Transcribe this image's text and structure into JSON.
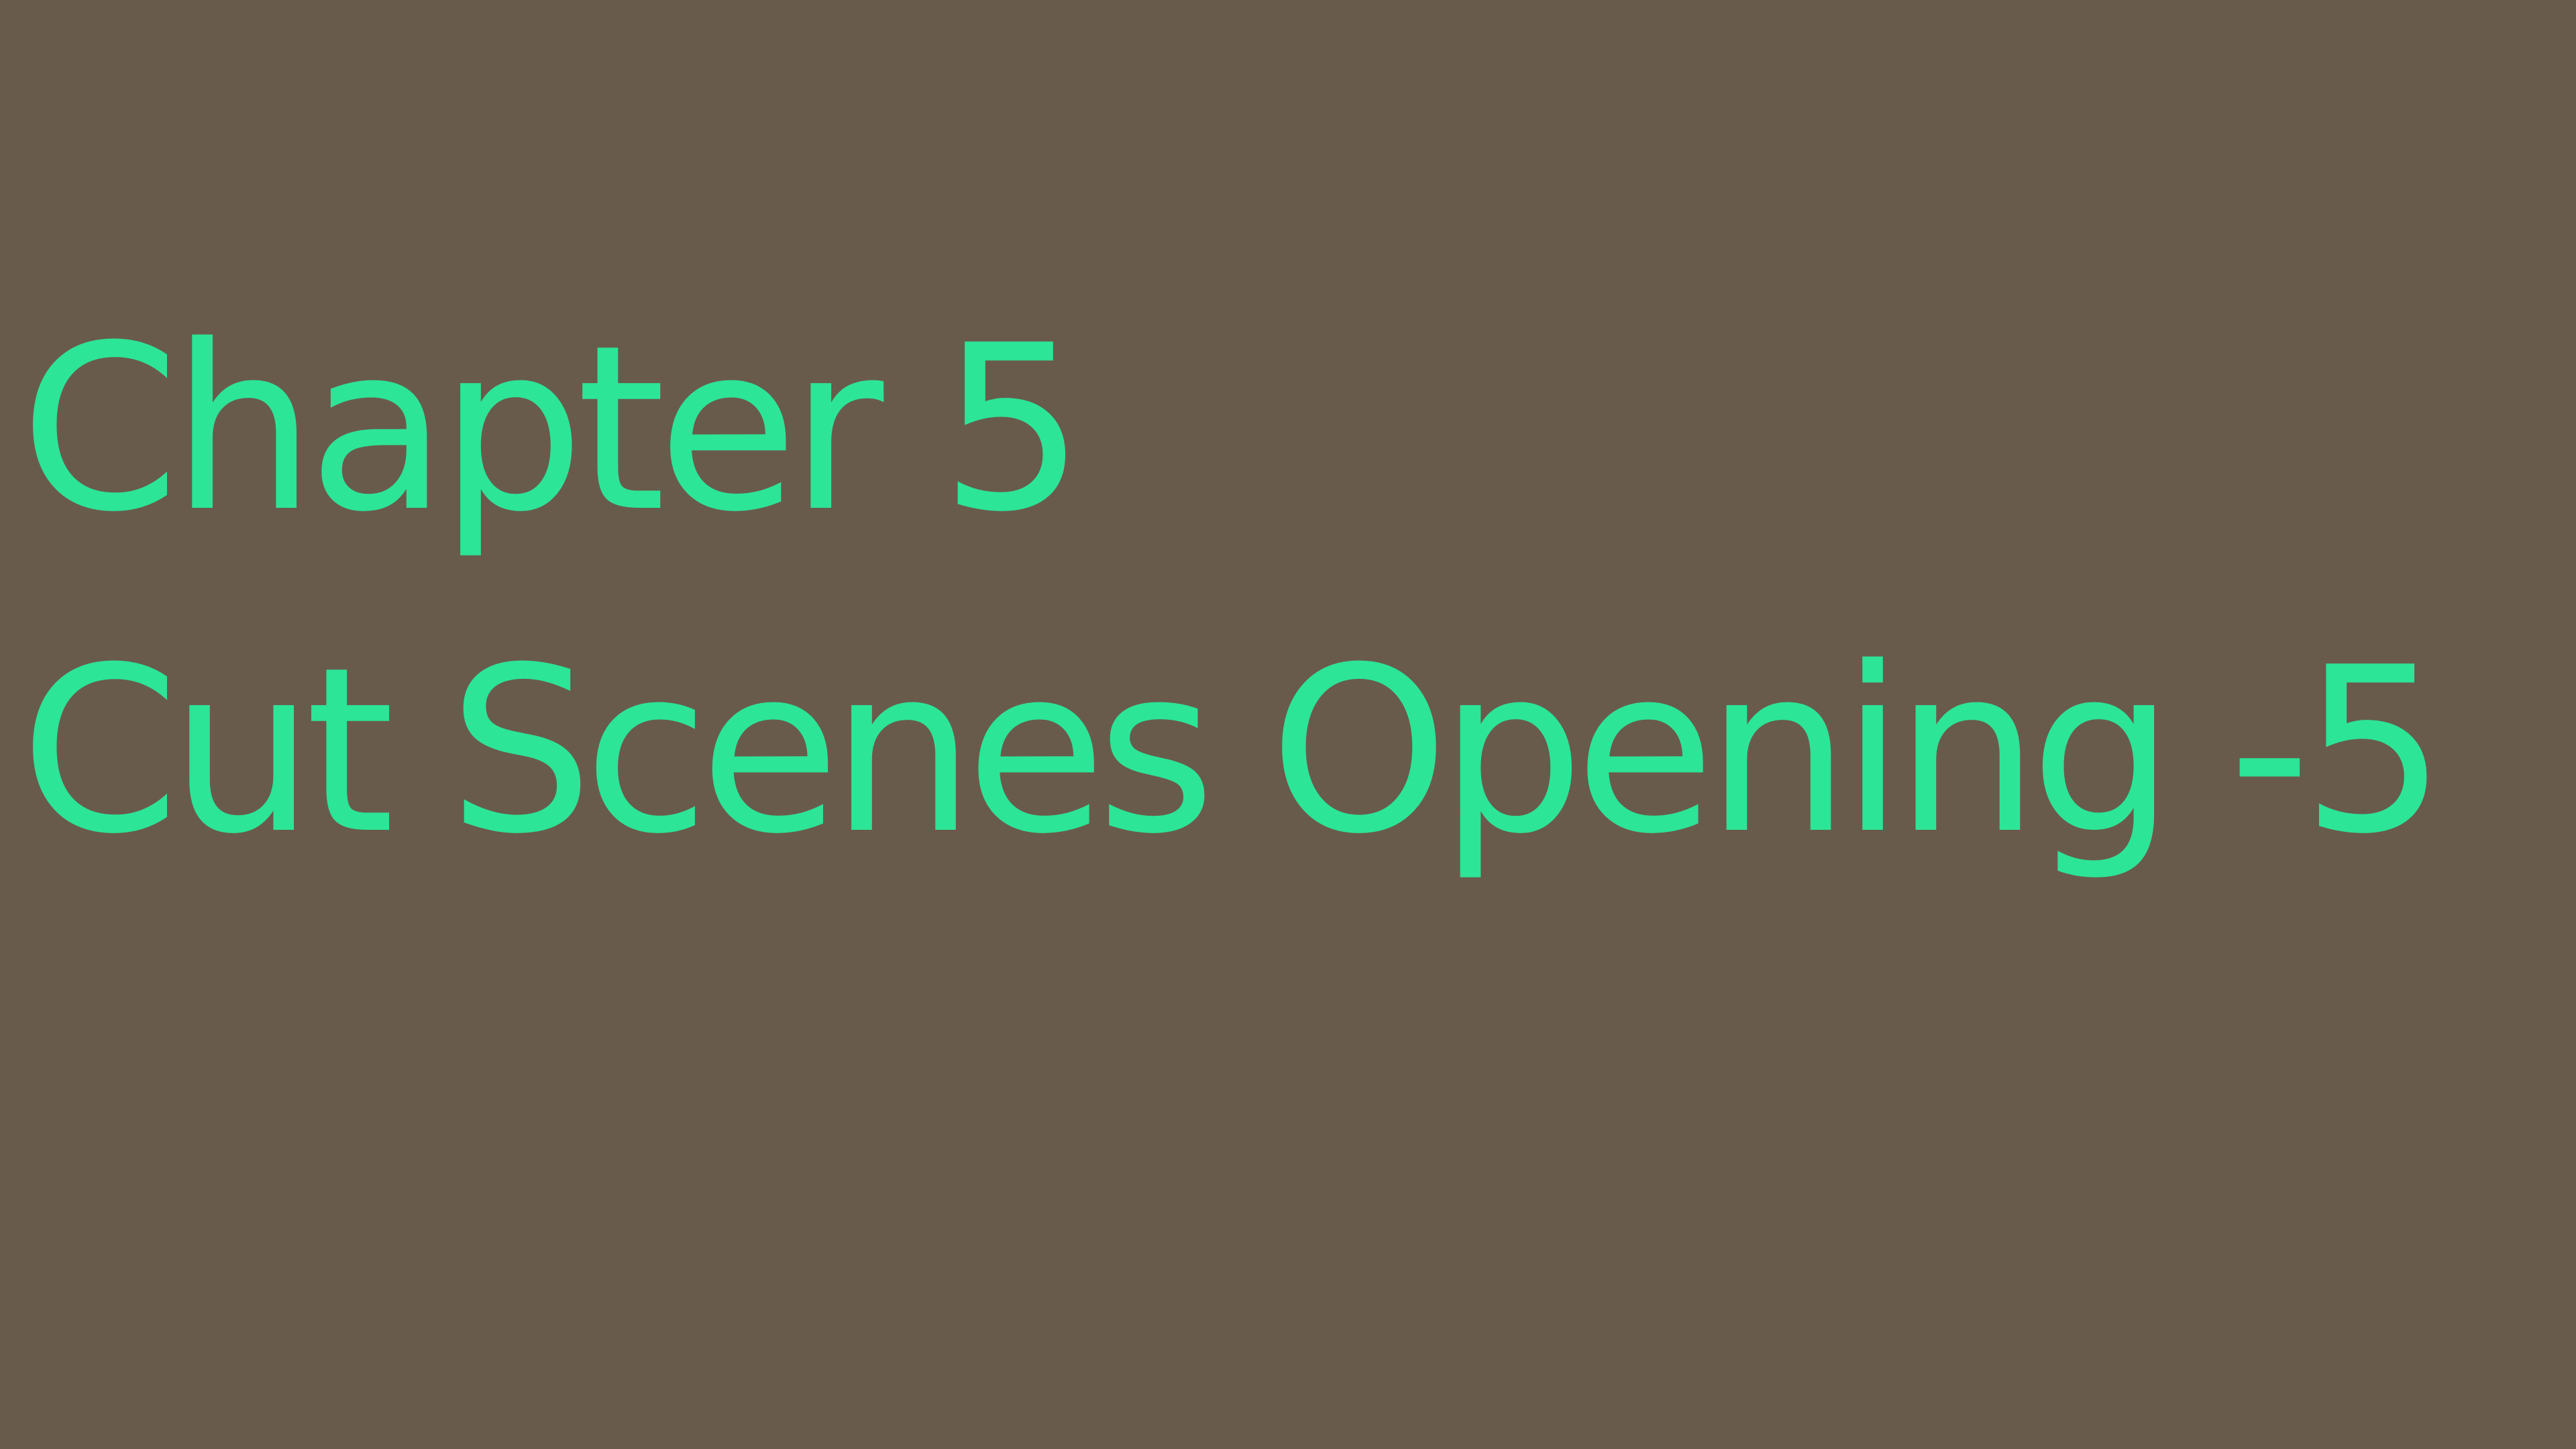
{
  "title_card": {
    "line1": "Chapter 5",
    "line2": "Cut Scenes Opening -5"
  },
  "colors": {
    "background": "#695b4c",
    "text": "#2ce597"
  }
}
